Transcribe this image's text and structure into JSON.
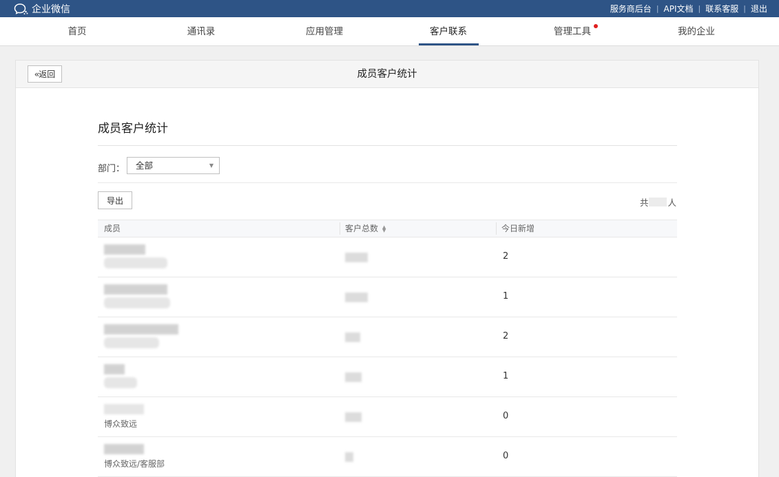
{
  "topbar": {
    "brand": "企业微信",
    "links": [
      "服务商后台",
      "API文档",
      "联系客服",
      "退出"
    ]
  },
  "nav": {
    "items": [
      "首页",
      "通讯录",
      "应用管理",
      "客户联系",
      "管理工具",
      "我的企业"
    ],
    "active": "客户联系"
  },
  "panel": {
    "back_label": "返回",
    "header_title": "成员客户统计",
    "section_title": "成员客户统计",
    "dept_label": "部门：",
    "dept_selected": "全部",
    "export_label": "导出",
    "total_prefix": "共",
    "total_suffix": "人"
  },
  "table": {
    "headers": [
      "成员",
      "客户总数",
      "今日新增"
    ],
    "rows": [
      {
        "dept": "",
        "today": "2"
      },
      {
        "dept": "",
        "today": "1"
      },
      {
        "dept": "",
        "today": "2"
      },
      {
        "dept": "",
        "today": "1"
      },
      {
        "dept": "博众致远",
        "today": "0"
      },
      {
        "dept": "博众致远/客服部",
        "today": "0"
      }
    ]
  },
  "colors": {
    "topbar": "#2e5486",
    "active_underline": "#2e5486",
    "notify_dot": "#e02020"
  }
}
